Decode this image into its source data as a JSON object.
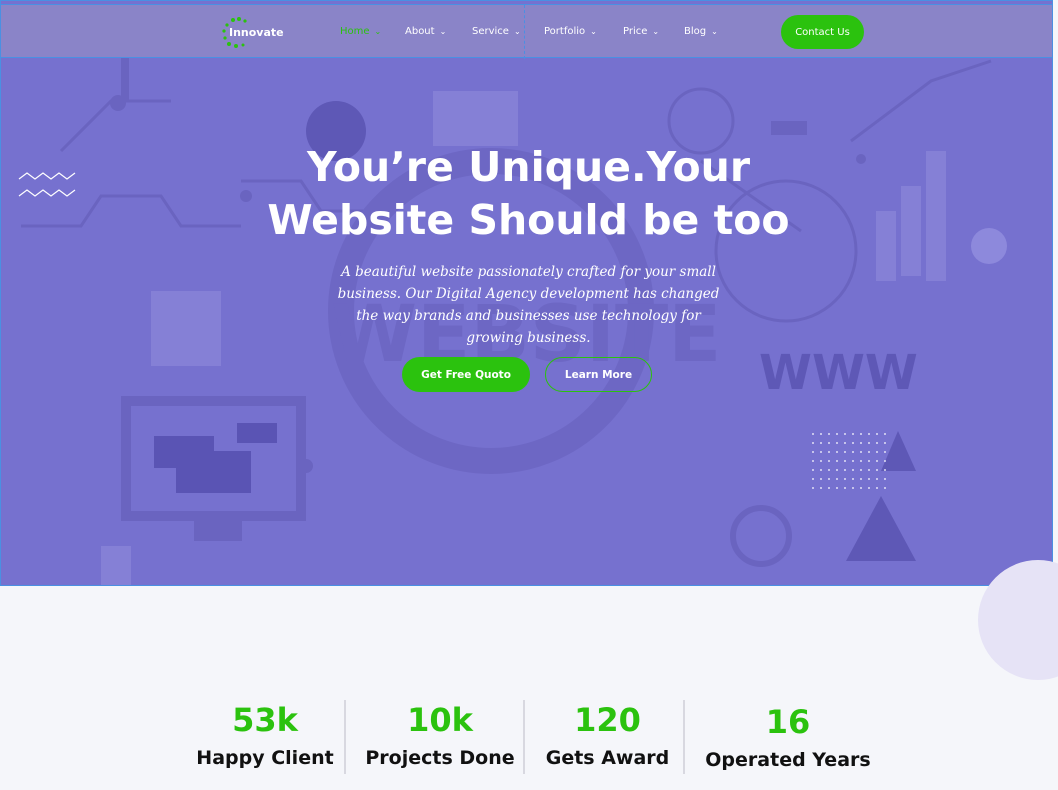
{
  "brand": {
    "name": "Innovate"
  },
  "nav": {
    "items": [
      {
        "label": "Home",
        "active": true
      },
      {
        "label": "About",
        "active": false
      },
      {
        "label": "Service",
        "active": false
      },
      {
        "label": "Portfolio",
        "active": false
      },
      {
        "label": "Price",
        "active": false
      },
      {
        "label": "Blog",
        "active": false
      }
    ],
    "dropdown_icon": "chevron-down-icon",
    "contact_label": "Contact Us"
  },
  "hero": {
    "title_line1": "You’re Unique.Your",
    "title_line2": "Website Should be too",
    "subtitle": "A beautiful website passionately crafted for your small business.  Our Digital Agency development has changed the way brands and businesses use technology for growing business.",
    "primary_cta": "Get Free Quoto",
    "secondary_cta": "Learn More",
    "background_words": [
      "WEBSITE",
      "WWW"
    ]
  },
  "stats": [
    {
      "value": "53k",
      "label": "Happy Client"
    },
    {
      "value": "10k",
      "label": "Projects Done"
    },
    {
      "value": "120",
      "label": "Gets Award"
    },
    {
      "value": "16",
      "label": "Operated Years"
    }
  ],
  "colors": {
    "accent": "#2bc20e",
    "hero_bg": "#7671cf",
    "nav_bg": "#8a84c8",
    "page_bg": "#f5f6fa",
    "text_dark": "#111111"
  }
}
